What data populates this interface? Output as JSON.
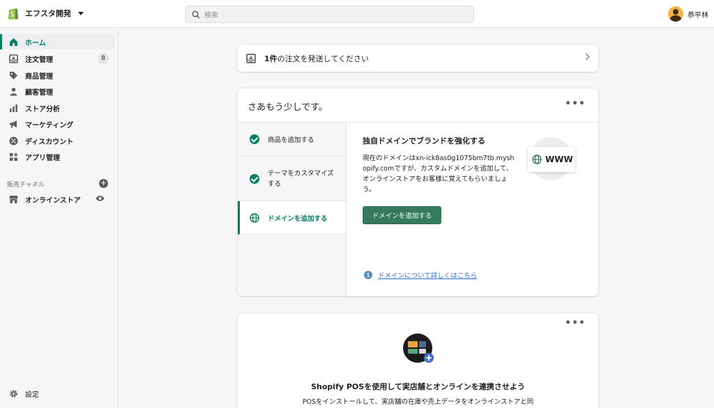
{
  "topbar": {
    "store_name": "エフスタ開発",
    "search_placeholder": "検索",
    "user_name": "恭平林"
  },
  "sidebar": {
    "items": [
      {
        "label": "ホーム",
        "icon": "home-icon"
      },
      {
        "label": "注文管理",
        "icon": "orders-icon",
        "badge": "8"
      },
      {
        "label": "商品管理",
        "icon": "tag-icon"
      },
      {
        "label": "顧客管理",
        "icon": "person-icon"
      },
      {
        "label": "ストア分析",
        "icon": "bar-chart-icon"
      },
      {
        "label": "マーケティング",
        "icon": "megaphone-icon"
      },
      {
        "label": "ディスカウント",
        "icon": "discount-icon"
      },
      {
        "label": "アプリ管理",
        "icon": "apps-icon"
      }
    ],
    "channels_label": "販売チャネル",
    "online_store": "オンラインストア",
    "settings": "設定"
  },
  "order_banner": {
    "count": "1件",
    "text": "の注文を発送してください"
  },
  "setup": {
    "title": "さあもう少しです。",
    "steps": [
      {
        "label": "商品を追加する",
        "done": true
      },
      {
        "label": "テーマをカスタマイズする",
        "done": true
      },
      {
        "label": "ドメインを追加する",
        "done": false
      }
    ],
    "content_title": "独自ドメインでブランドを強化する",
    "content_desc": "現在のドメインはxn-ick8as0g1075bm7tb.myshopify.comですが、カスタムドメインを追加して、オンラインストアをお客様に覚えてもらいましょう。",
    "button": "ドメインを追加する",
    "learn_more": "ドメインについて詳しくはこちら",
    "illustration_text": "WWW"
  },
  "pos": {
    "title": "Shopify POSを使用して実店舗とオンラインを連携させよう",
    "desc": "POSをインストールして、実店舗の在庫や売上データをオンラインストアと同"
  },
  "colors": {
    "accent": "#008060",
    "button": "#367a5d",
    "link": "#2c6ecb"
  }
}
